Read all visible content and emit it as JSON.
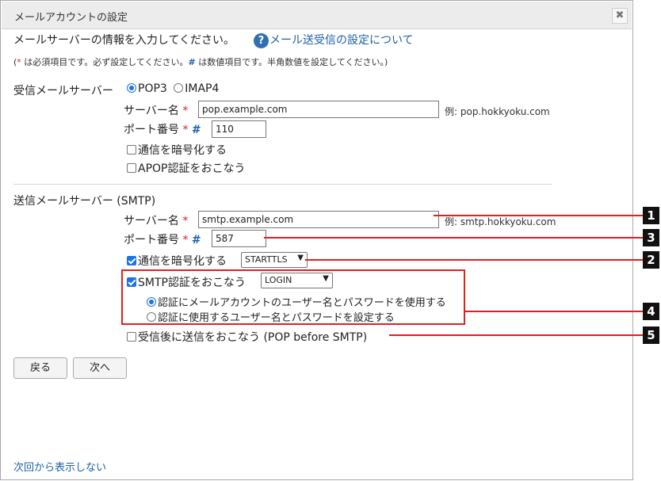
{
  "dialog": {
    "title": "メールアカウントの設定",
    "close_glyph": "✖"
  },
  "intro": "メールサーバーの情報を入力してください。",
  "help": {
    "icon": "?",
    "link": "メール送受信の設定について"
  },
  "note": {
    "open": "(",
    "req_mark": "*",
    "part1": " は必須項目です。必ず設定してください。",
    "num_mark": "#",
    "part2": " は数値項目です。半角数値を設定してください。)"
  },
  "incoming": {
    "label": "受信メールサーバー",
    "pop3": "POP3",
    "imap4": "IMAP4",
    "server_label": "サーバー名",
    "server_value": "pop.example.com",
    "server_example": "例: pop.hokkyoku.com",
    "port_label": "ポート番号",
    "port_value": "110",
    "encrypt_label": "通信を暗号化する",
    "apop_label": "APOP認証をおこなう"
  },
  "outgoing": {
    "label": "送信メールサーバー (SMTP)",
    "server_label": "サーバー名",
    "server_value": "smtp.example.com",
    "server_example": "例: smtp.hokkyoku.com",
    "port_label": "ポート番号",
    "port_value": "587",
    "encrypt_label": "通信を暗号化する",
    "encrypt_select": "STARTTLS",
    "smtp_auth_label": "SMTP認証をおこなう",
    "smtp_auth_select": "LOGIN",
    "auth_opt1": "認証にメールアカウントのユーザー名とパスワードを使用する",
    "auth_opt2": "認証に使用するユーザー名とパスワードを設定する",
    "pop_before_smtp": "受信後に送信をおこなう (POP before SMTP)"
  },
  "marks": {
    "required": "*",
    "numeric": "#"
  },
  "buttons": {
    "back": "戻る",
    "next": "次へ"
  },
  "footer": {
    "dont_show": "次回から表示しない"
  },
  "callouts": [
    "1",
    "3",
    "2",
    "4",
    "5"
  ],
  "colors": {
    "link": "#1d5fa8",
    "required": "#e02020",
    "callout": "#e02020",
    "badge": "#111111"
  }
}
